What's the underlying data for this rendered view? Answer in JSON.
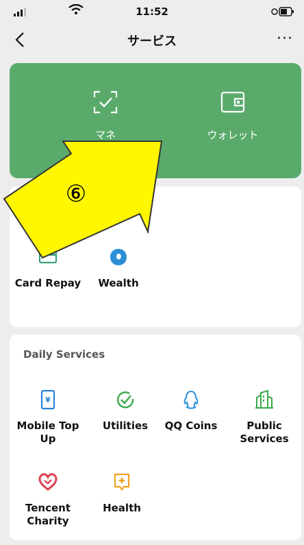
{
  "status_bar": {
    "time": "11:52"
  },
  "nav": {
    "title": "サービス",
    "more": "···"
  },
  "wallet_panel": {
    "money_label": "マネ",
    "wallet_label": "ウォレット",
    "accent": "#5aab6b"
  },
  "financial_services": {
    "items": [
      {
        "label": "Card Repay",
        "icon": "card-repay-icon"
      },
      {
        "label": "Wealth",
        "icon": "wealth-icon"
      }
    ]
  },
  "daily_services": {
    "title": "Daily Services",
    "items": [
      {
        "label": "Mobile Top Up",
        "icon": "mobile-top-up-icon"
      },
      {
        "label": "Utilities",
        "icon": "utilities-icon"
      },
      {
        "label": "QQ Coins",
        "icon": "qq-coins-icon"
      },
      {
        "label": "Public Services",
        "icon": "public-services-icon"
      },
      {
        "label": "Tencent Charity",
        "icon": "tencent-charity-icon"
      },
      {
        "label": "Health",
        "icon": "health-icon"
      }
    ]
  },
  "annotation": {
    "step": "⑥",
    "color": "#fff700"
  }
}
